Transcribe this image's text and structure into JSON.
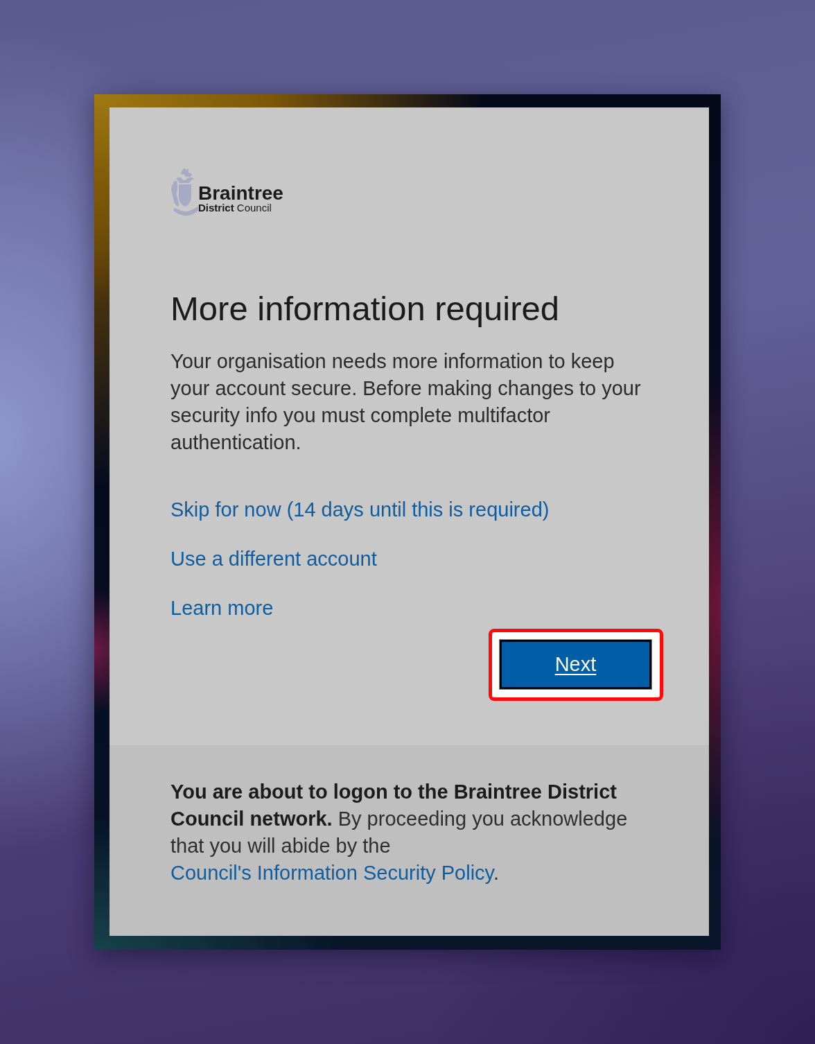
{
  "logo": {
    "title": "Braintree",
    "subtitle": "**District** Council"
  },
  "heading": "More information required",
  "description": "Your organisation needs more information to keep your account secure. Before making changes to your security info you must complete multifactor authentication.",
  "links": [
    {
      "label": "Skip for now (14 days until this is required)"
    },
    {
      "label": "Use a different account"
    },
    {
      "label": "Learn more"
    }
  ],
  "next_button": {
    "label": "Next",
    "highlighted": true
  },
  "footer": {
    "lead": "You are about to logon to the Braintree District Council network.",
    "text": "By proceeding you acknowledge that you will abide by the",
    "link": "Council's Information Security Policy",
    "end": "."
  }
}
